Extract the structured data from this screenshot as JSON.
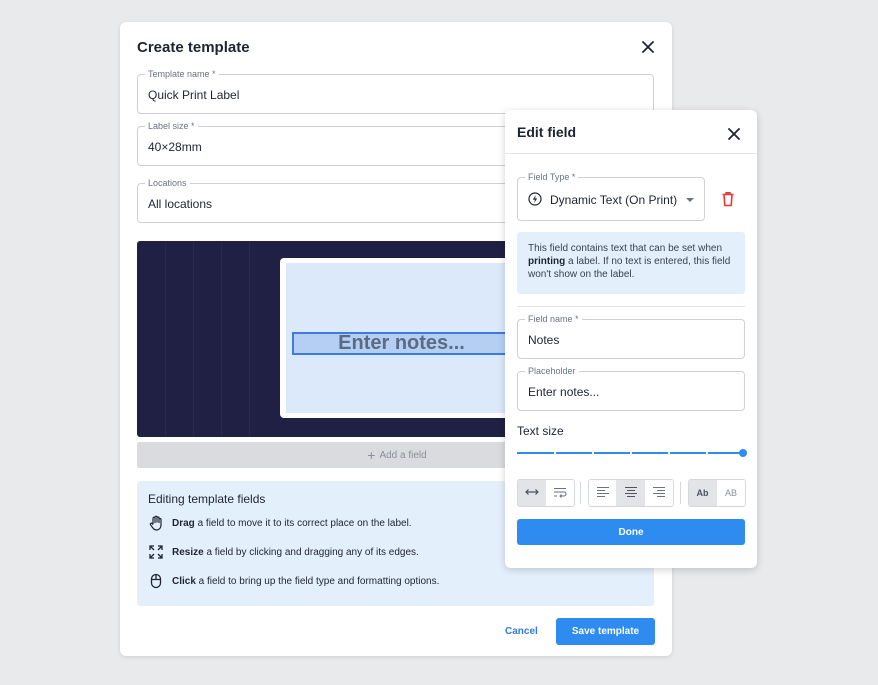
{
  "create_dialog": {
    "title": "Create template",
    "close_icon": "close-icon",
    "template_name": {
      "label": "Template name *",
      "value": "Quick Print Label"
    },
    "label_size": {
      "label": "Label size *",
      "value": "40×28mm"
    },
    "locations": {
      "label": "Locations",
      "value": "All locations"
    },
    "canvas": {
      "field_text": "Enter notes..."
    },
    "add_field": {
      "icon": "plus-icon",
      "label": "Add a field"
    },
    "help": {
      "title": "Editing template fields",
      "rows": [
        {
          "icon": "hand-drag-icon",
          "bold": "Drag",
          "text": " a field to move it to its correct place on the label."
        },
        {
          "icon": "resize-icon",
          "bold": "Resize",
          "text": " a field by clicking and dragging any of its edges."
        },
        {
          "icon": "mouse-click-icon",
          "bold": "Click",
          "text": " a field to bring up the field type and formatting options."
        }
      ]
    },
    "cancel_label": "Cancel",
    "save_label": "Save template"
  },
  "edit_panel": {
    "title": "Edit field",
    "close_icon": "close-icon",
    "field_type": {
      "label": "Field Type *",
      "icon": "lightning-circle-icon",
      "value": "Dynamic Text (On Print)"
    },
    "delete_icon": "trash-icon",
    "info": {
      "text_before": "This field contains text that can be set when ",
      "bold": "printing",
      "text_after": " a label. If no text is entered, this field won't show on the label."
    },
    "field_name": {
      "label": "Field name *",
      "value": "Notes"
    },
    "placeholder": {
      "label": "Placeholder",
      "value": "Enter notes..."
    },
    "text_size": {
      "label": "Text size",
      "level_percent": 100
    },
    "format_buttons": {
      "wrap_mode": [
        {
          "icon": "no-wrap-arrows-icon",
          "selected": true
        },
        {
          "icon": "text-wrap-icon",
          "selected": false
        }
      ],
      "alignment": [
        {
          "icon": "align-left-icon",
          "selected": false
        },
        {
          "icon": "align-center-icon",
          "selected": true
        },
        {
          "icon": "align-right-icon",
          "selected": false
        }
      ],
      "case": [
        {
          "label": "Ab",
          "selected": true
        },
        {
          "label": "AB",
          "selected": false
        }
      ]
    },
    "done_label": "Done"
  },
  "colors": {
    "accent": "#2e8bf0",
    "canvas": "#1f2043",
    "info_bg": "#e3f0fc",
    "danger": "#e53935"
  }
}
